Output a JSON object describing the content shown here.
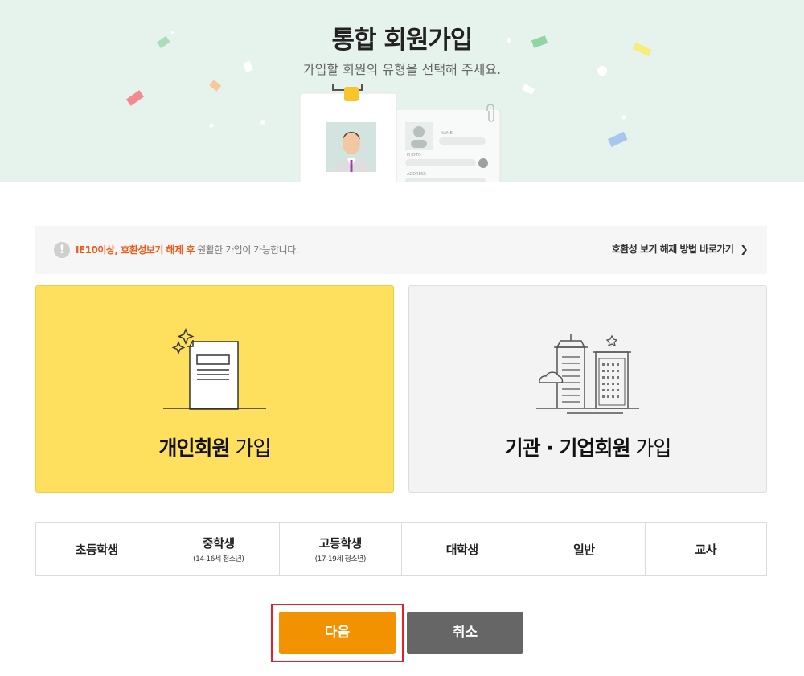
{
  "header": {
    "title": "통합 회원가입",
    "subtitle": "가입할 회원의 유형을 선택해 주세요."
  },
  "illustration": {
    "name_label": "NAME",
    "photo_label": "PHOTO",
    "address_label": "ADDRESS"
  },
  "notice": {
    "highlight": "IE10이상, 호환성보기 해제 후",
    "text": " 원활한 가입이 가능합니다.",
    "link": "호환성 보기 해제 방법 바로가기",
    "link_icon": "chevron-right-icon"
  },
  "member_types": [
    {
      "bold": "개인회원",
      "rest": " 가입"
    },
    {
      "bold": "기관 · 기업회원",
      "rest": " 가입"
    }
  ],
  "categories": [
    {
      "label": "초등학생",
      "sub": ""
    },
    {
      "label": "중학생",
      "sub": "(14-16세 청소년)"
    },
    {
      "label": "고등학생",
      "sub": "(17-19세 청소년)"
    },
    {
      "label": "대학생",
      "sub": ""
    },
    {
      "label": "일반",
      "sub": ""
    },
    {
      "label": "교사",
      "sub": ""
    }
  ],
  "buttons": {
    "next": "다음",
    "cancel": "취소"
  },
  "colors": {
    "banner_bg": "#e5f3ec",
    "personal_card": "#ffdf5e",
    "corporate_card": "#f3f3f3",
    "highlight_text": "#f05a14",
    "next_button": "#f39200",
    "cancel_button": "#666666",
    "selection_outline": "#e0222b"
  }
}
